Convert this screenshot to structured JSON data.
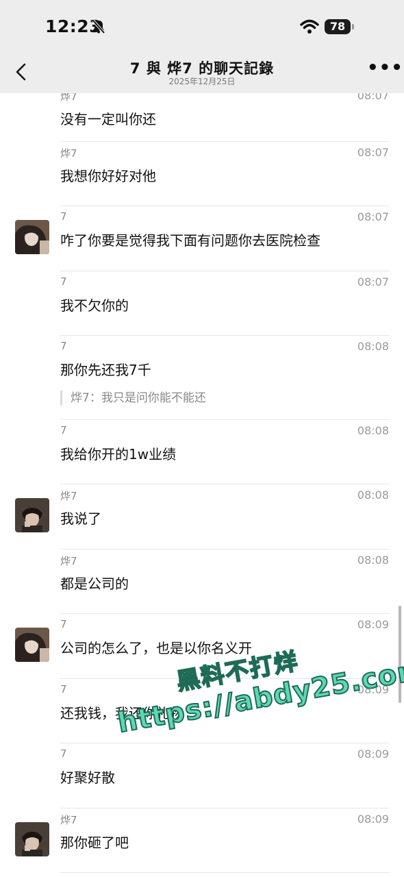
{
  "status": {
    "time": "12:23",
    "battery": "78"
  },
  "header": {
    "title": "7 與 烨7 的聊天記錄",
    "date": "2025年12月25日"
  },
  "messages": [
    {
      "sender": "烨7",
      "time": "08:07",
      "text": "没有一定叫你还",
      "avatar": null
    },
    {
      "sender": "烨7",
      "time": "08:07",
      "text": "我想你好好对他",
      "avatar": null
    },
    {
      "sender": "7",
      "time": "08:07",
      "text": "咋了你要是觉得我下面有问题你去医院检查",
      "avatar": "woman-avatar"
    },
    {
      "sender": "7",
      "time": "08:07",
      "text": "我不欠你的",
      "avatar": null
    },
    {
      "sender": "7",
      "time": "08:08",
      "text": "那你先还我7千",
      "avatar": null,
      "quote": "烨7：我只是问你能不能还"
    },
    {
      "sender": "7",
      "time": "08:08",
      "text": "我给你开的1w业绩",
      "avatar": null
    },
    {
      "sender": "烨7",
      "time": "08:08",
      "text": "我说了",
      "avatar": "man-avatar"
    },
    {
      "sender": "烨7",
      "time": "08:08",
      "text": "都是公司的",
      "avatar": null
    },
    {
      "sender": "7",
      "time": "08:09",
      "text": "公司的怎么了，也是以你名义开",
      "avatar": "woman-avatar"
    },
    {
      "sender": "7",
      "time": "08:09",
      "text": "还我钱，我还你礼物",
      "avatar": null
    },
    {
      "sender": "7",
      "time": "08:09",
      "text": "好聚好散",
      "avatar": null
    },
    {
      "sender": "烨7",
      "time": "08:09",
      "text": "那你砸了吧",
      "avatar": "man-avatar"
    }
  ],
  "watermark": {
    "line1": "黑料不打烊",
    "line2": "https://abdy25.com"
  },
  "colors": {
    "bar": "#ededed",
    "watermark": "#5ed7b5"
  }
}
